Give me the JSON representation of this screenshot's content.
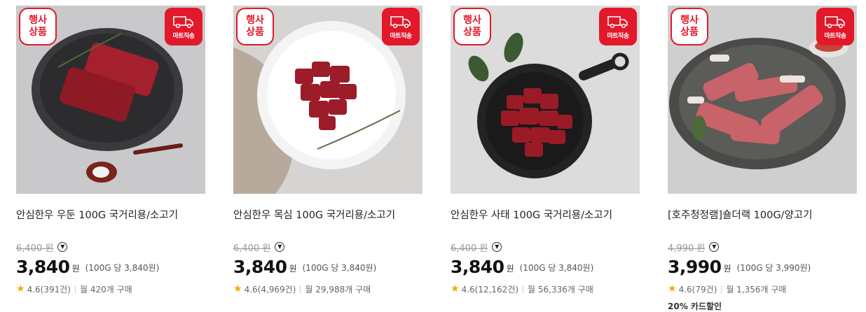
{
  "products": [
    {
      "badge_event": [
        "행사",
        "상품"
      ],
      "badge_mart": "마트직송",
      "name": "안심한우 우둔 100G 국거리용/소고기",
      "original_price": "6,400 원",
      "price": "3,840",
      "currency": "원",
      "unit_price": "(100G 당 3,840원)",
      "rating": "4.6(391건)",
      "monthly": "월 420개 구매",
      "discount": ""
    },
    {
      "badge_event": [
        "행사",
        "상품"
      ],
      "badge_mart": "마트직송",
      "name": "안심한우 목심 100G 국거리용/소고기",
      "original_price": "6,400 원",
      "price": "3,840",
      "currency": "원",
      "unit_price": "(100G 당 3,840원)",
      "rating": "4.6(4,969건)",
      "monthly": "월 29,988개 구매",
      "discount": ""
    },
    {
      "badge_event": [
        "행사",
        "상품"
      ],
      "badge_mart": "마트직송",
      "name": "안심한우 사태 100G 국거리용/소고기",
      "original_price": "6,400 원",
      "price": "3,840",
      "currency": "원",
      "unit_price": "(100G 당 3,840원)",
      "rating": "4.6(12,162건)",
      "monthly": "월 56,336개 구매",
      "discount": ""
    },
    {
      "badge_event": [
        "행사",
        "상품"
      ],
      "badge_mart": "마트직송",
      "name": "[호주청정램]숄더랙 100G/양고기",
      "original_price": "4,990 원",
      "price": "3,990",
      "currency": "원",
      "unit_price": "(100G 당 3,990원)",
      "rating": "4.6(79건)",
      "monthly": "월 1,356개 구매",
      "discount": "20% 카드할인"
    }
  ],
  "icons": {
    "star": "star-icon",
    "info": "chevron-down-circle-icon",
    "truck": "truck-icon"
  },
  "colors": {
    "accent": "#e2192a",
    "star": "#f6a800"
  }
}
